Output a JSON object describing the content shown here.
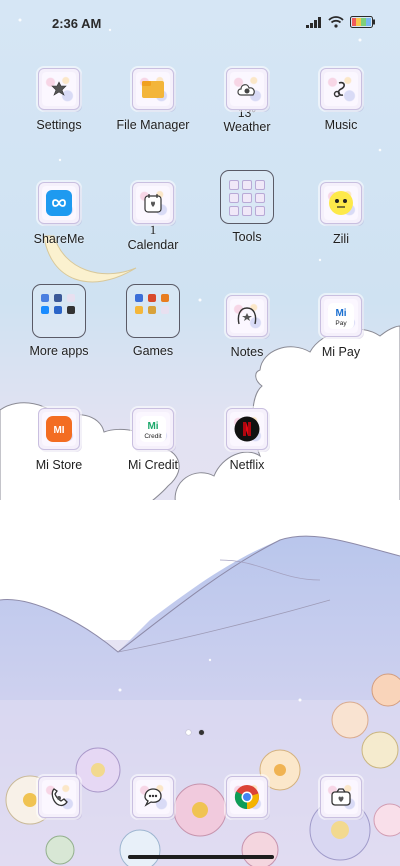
{
  "status": {
    "time": "2:36 AM"
  },
  "apps": [
    {
      "label": "Settings",
      "icon": "settings-icon"
    },
    {
      "label": "File Manager",
      "icon": "folder-icon"
    },
    {
      "label": "Weather",
      "icon": "weather-icon",
      "temp": "13°"
    },
    {
      "label": "Music",
      "icon": "music-icon"
    },
    {
      "label": "ShareMe",
      "icon": "shareme-icon"
    },
    {
      "label": "Calendar",
      "icon": "calendar-icon",
      "day": "1"
    },
    {
      "label": "Tools",
      "icon": "tools-folder-icon"
    },
    {
      "label": "Zili",
      "icon": "zili-icon"
    },
    {
      "label": "More apps",
      "icon": "more-apps-folder-icon"
    },
    {
      "label": "Games",
      "icon": "games-folder-icon"
    },
    {
      "label": "Notes",
      "icon": "notes-icon"
    },
    {
      "label": "Mi Pay",
      "icon": "mi-pay-icon",
      "badge": "Pay"
    },
    {
      "label": "Mi Store",
      "icon": "mi-store-icon"
    },
    {
      "label": "Mi Credit",
      "icon": "mi-credit-icon",
      "badge": "Credit"
    },
    {
      "label": "Netflix",
      "icon": "netflix-icon"
    }
  ],
  "dock": [
    {
      "icon": "phone-icon"
    },
    {
      "icon": "messages-icon"
    },
    {
      "icon": "chrome-icon"
    },
    {
      "icon": "camera-icon"
    }
  ],
  "pages": {
    "count": 2,
    "active": 2
  },
  "colors": {
    "sky": "#cfe1f3",
    "cloud": "#ffffff",
    "mountain": "#c8c6ea",
    "battery": "#f05a5a"
  }
}
